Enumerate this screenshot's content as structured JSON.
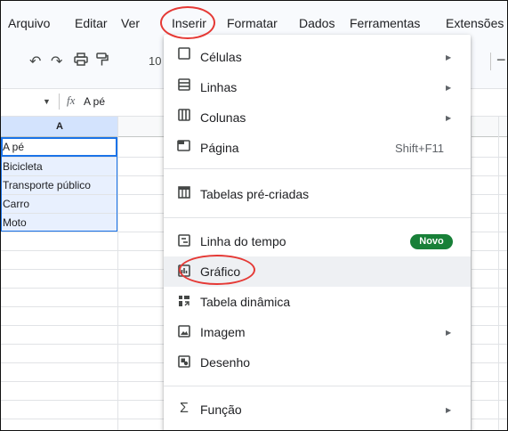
{
  "menubar": {
    "items": [
      "Arquivo",
      "Editar",
      "Ver",
      "Inserir",
      "Formatar",
      "Dados",
      "Ferramentas",
      "Extensões"
    ]
  },
  "toolbar": {
    "icons": [
      "undo-icon",
      "redo-icon",
      "print-icon",
      "paint-format-icon"
    ],
    "zoom_partial": "10"
  },
  "formula_bar": {
    "fx_label": "fx",
    "value": "A pé"
  },
  "grid": {
    "column_a_header": "A",
    "cells": [
      "A pé",
      "Bicicleta",
      "Transporte público",
      "Carro",
      "Moto"
    ]
  },
  "insert_menu": {
    "items": [
      {
        "label": "Células",
        "icon": "cells-icon",
        "submenu": true
      },
      {
        "label": "Linhas",
        "icon": "rows-icon",
        "submenu": true
      },
      {
        "label": "Colunas",
        "icon": "columns-icon",
        "submenu": true
      },
      {
        "label": "Página",
        "icon": "sheet-icon",
        "shortcut": "Shift+F11"
      },
      {
        "label": "Tabelas pré-criadas",
        "icon": "table-icon"
      },
      {
        "label": "Linha do tempo",
        "icon": "timeline-icon",
        "badge": "Novo"
      },
      {
        "label": "Gráfico",
        "icon": "chart-icon"
      },
      {
        "label": "Tabela dinâmica",
        "icon": "pivot-table-icon"
      },
      {
        "label": "Imagem",
        "icon": "image-icon",
        "submenu": true
      },
      {
        "label": "Desenho",
        "icon": "drawing-icon"
      },
      {
        "label": "Função",
        "icon": "sigma-icon",
        "submenu": true
      }
    ]
  },
  "annotation_color": "#e53935",
  "accent_color": "#1a73e8",
  "badge_color": "#188038"
}
